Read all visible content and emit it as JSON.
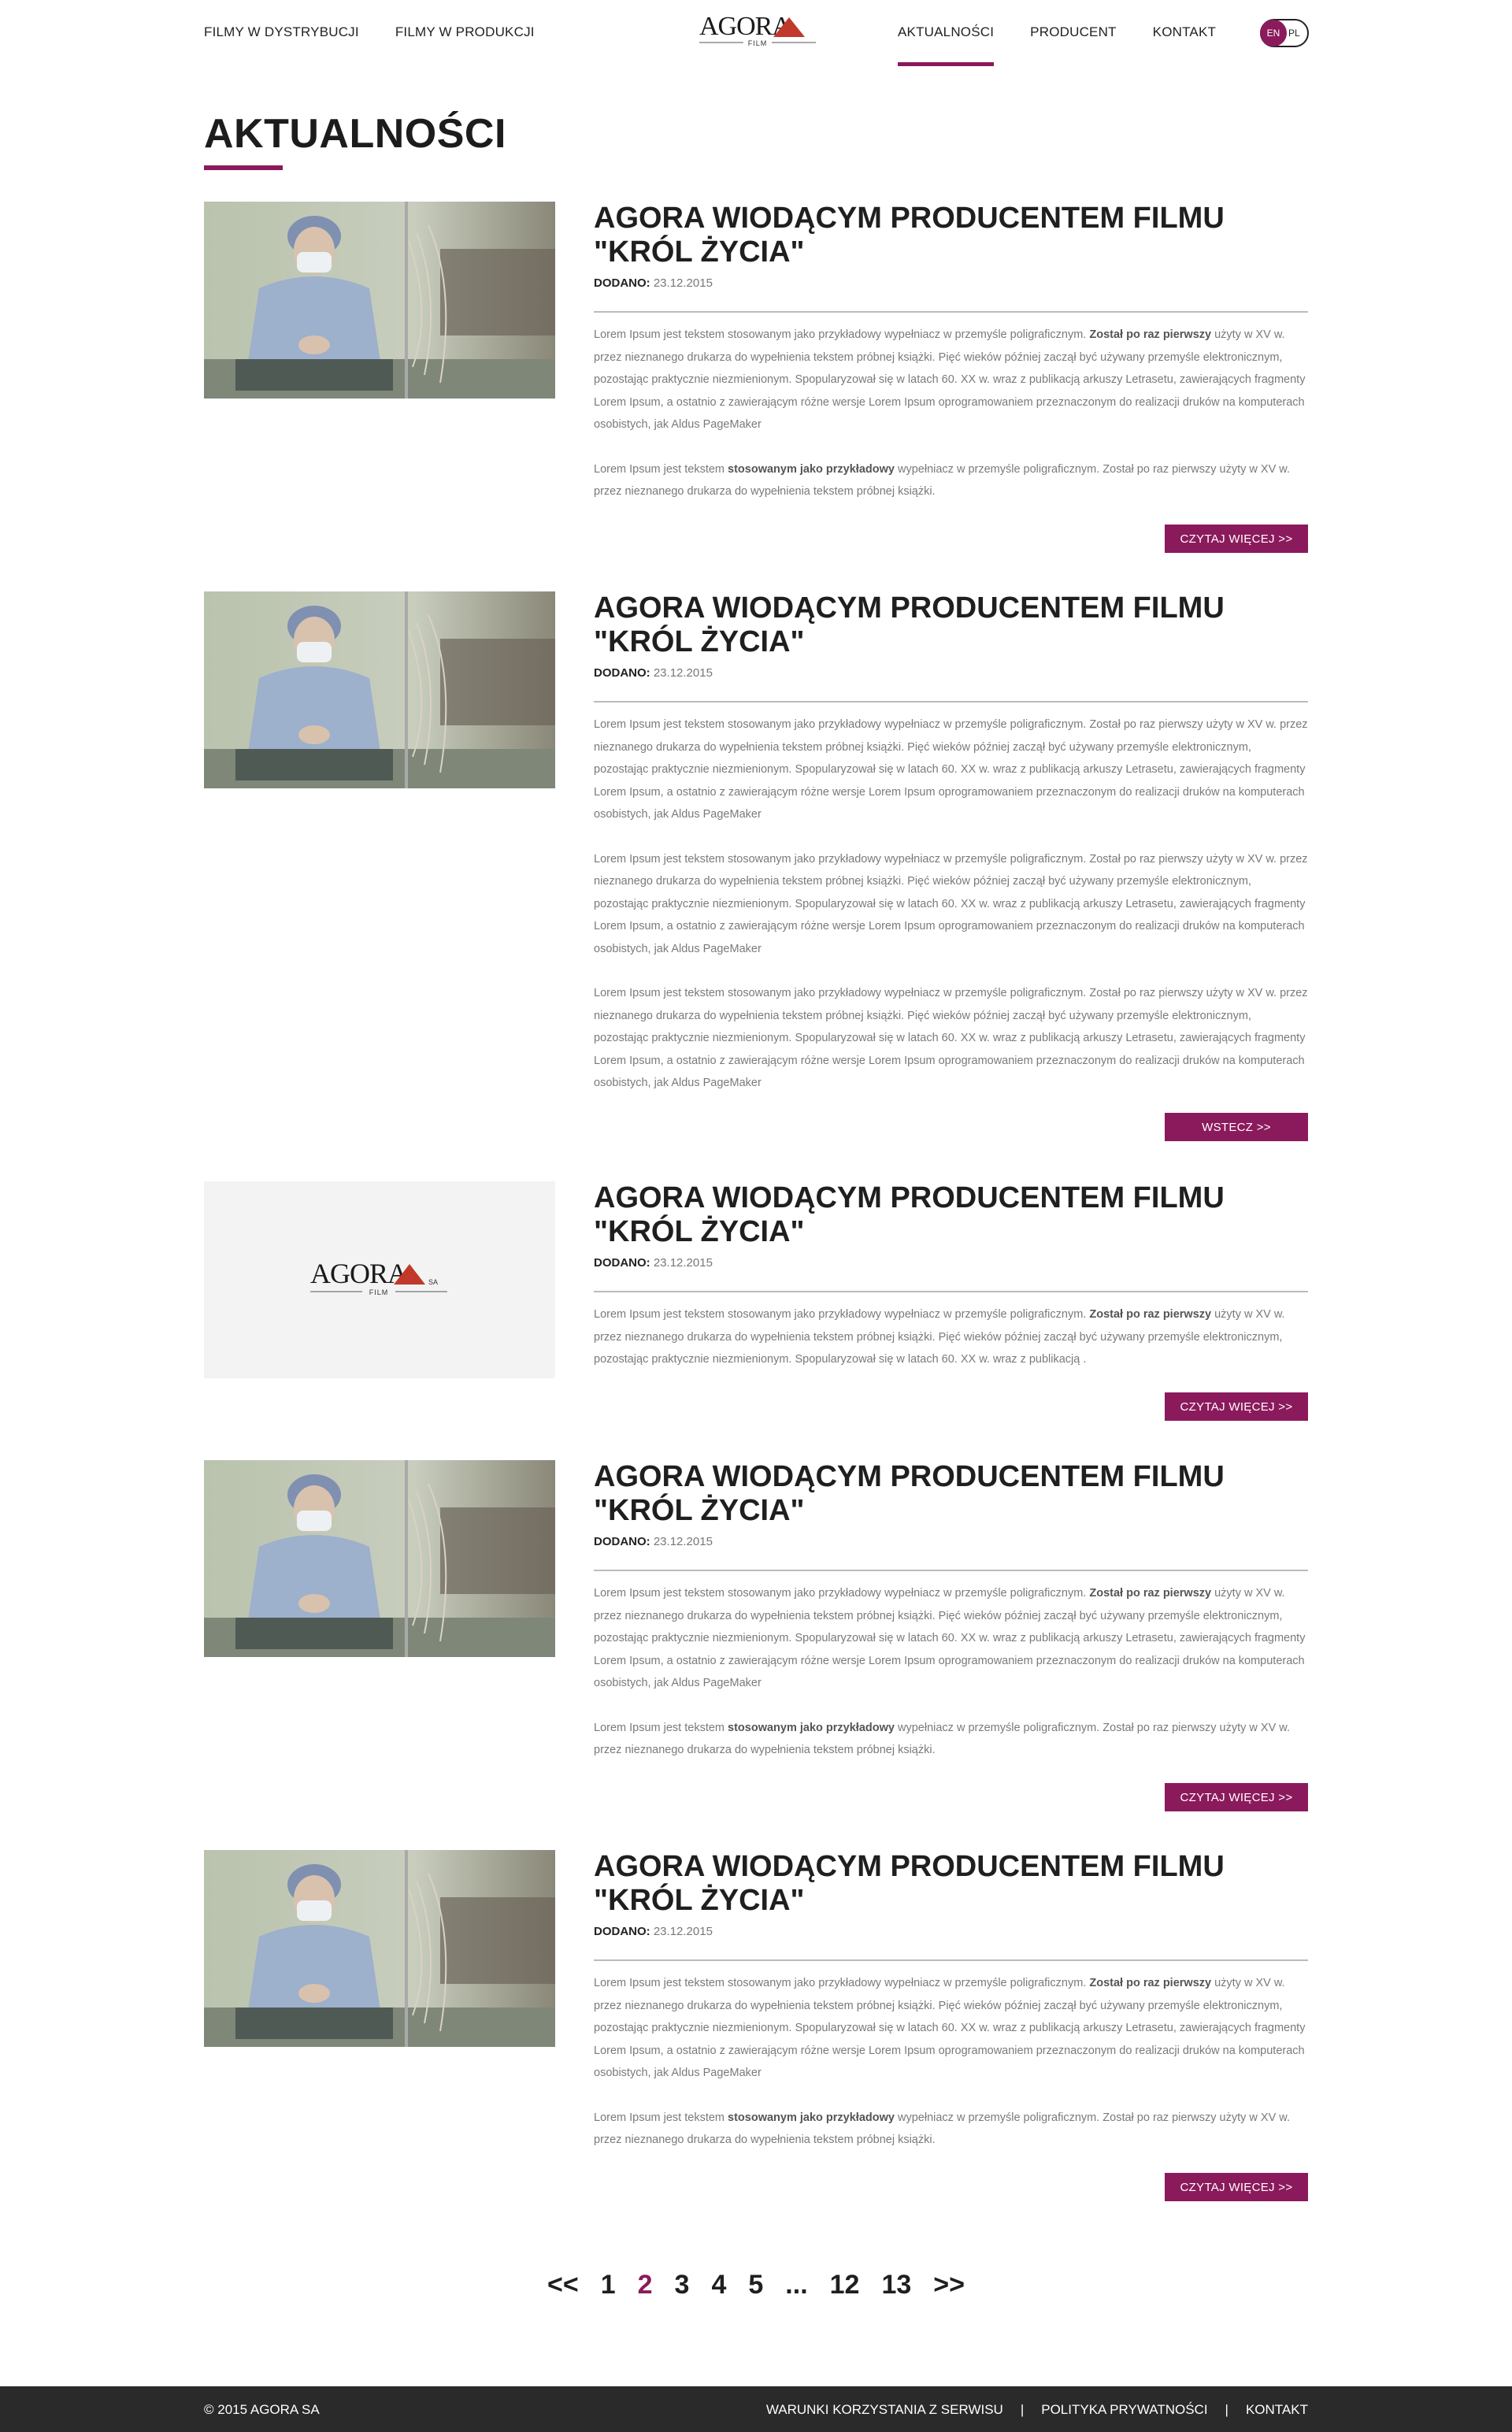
{
  "header": {
    "nav_left": [
      "FILMY W DYSTRYBUCJI",
      "FILMY W PRODUKCJI"
    ],
    "nav_right": [
      "AKTUALNOŚCI",
      "PRODUCENT",
      "KONTAKT"
    ],
    "active": "AKTUALNOŚCI",
    "logo_text": "AGORA",
    "logo_sub": "FILM",
    "lang": {
      "active": "EN",
      "other": "PL"
    }
  },
  "page": {
    "title": "AKTUALNOŚCI"
  },
  "colors": {
    "accent": "#8b1a5c",
    "footer_bg": "#2a2a2a"
  },
  "articles": [
    {
      "title_line1": "AGORA WIODĄCYM PRODUCENTEM FILMU",
      "title_line2": "\"KRÓL ŻYCIA\"",
      "meta_label": "DODANO:",
      "date": "23.12.2015",
      "button": "CZYTAJ WIĘCEJ >>",
      "image": "photo"
    },
    {
      "title_line1": "AGORA WIODĄCYM PRODUCENTEM FILMU",
      "title_line2": "\"KRÓL ŻYCIA\"",
      "meta_label": "DODANO:",
      "date": "23.12.2015",
      "button": "WSTECZ >>",
      "image": "photo"
    },
    {
      "title_line1": "AGORA WIODĄCYM PRODUCENTEM FILMU",
      "title_line2": "\"KRÓL ŻYCIA\"",
      "meta_label": "DODANO:",
      "date": "23.12.2015",
      "button": "CZYTAJ WIĘCEJ >>",
      "image": "logo",
      "logo_text": "AGORA",
      "logo_suffix": "SA",
      "logo_sub": "FILM"
    },
    {
      "title_line1": "AGORA WIODĄCYM PRODUCENTEM FILMU",
      "title_line2": "\"KRÓL ŻYCIA\"",
      "meta_label": "DODANO:",
      "date": "23.12.2015",
      "button": "CZYTAJ WIĘCEJ >>",
      "image": "photo"
    },
    {
      "title_line1": "AGORA WIODĄCYM PRODUCENTEM FILMU",
      "title_line2": "\"KRÓL ŻYCIA\"",
      "meta_label": "DODANO:",
      "date": "23.12.2015",
      "button": "CZYTAJ WIĘCEJ >>",
      "image": "photo"
    }
  ],
  "texts": {
    "p1_pre": "Lorem Ipsum jest tekstem stosowanym jako przykładowy wypełniacz w przemyśle poligraficznym. ",
    "p1_bold": "Został po raz pierwszy",
    "p1_post": " użyty w XV w. przez nieznanego drukarza do wypełnienia tekstem próbnej książki. Pięć wieków później zaczął być używany przemyśle elektronicznym, pozostając praktycznie niezmienionym. Spopularyzował się w latach 60. XX w. wraz z publikacją arkuszy Letrasetu, zawierających fragmenty Lorem Ipsum, a ostatnio z zawierającym różne wersje Lorem Ipsum oprogramowaniem przeznaczonym do realizacji druków na komputerach osobistych, jak Aldus PageMaker",
    "p2_pre": "Lorem Ipsum jest tekstem ",
    "p2_bold": "stosowanym jako przykładowy",
    "p2_post": " wypełniacz w przemyśle poligraficznym. Został po raz pierwszy użyty w XV w. przez nieznanego drukarza do wypełnienia tekstem próbnej książki.",
    "full": "Lorem Ipsum jest tekstem stosowanym jako przykładowy wypełniacz w przemyśle poligraficznym. Został po raz pierwszy użyty w XV w. przez nieznanego drukarza do wypełnienia tekstem próbnej książki. Pięć wieków później zaczął być używany przemyśle elektronicznym, pozostając praktycznie niezmienionym. Spopularyzował się w latach 60. XX w. wraz z publikacją arkuszy Letrasetu, zawierających fragmenty Lorem Ipsum, a ostatnio z zawierającym różne wersje Lorem Ipsum oprogramowaniem przeznaczonym do realizacji druków na komputerach osobistych, jak Aldus PageMaker",
    "short_post": " użyty w XV w. przez nieznanego drukarza do wypełnienia tekstem próbnej książki. Pięć wieków później zaczął być używany przemyśle elektronicznym, pozostając praktycznie niezmienionym. Spopularyzował się w latach 60. XX w. wraz z publikacją ."
  },
  "pagination": [
    "<<",
    "1",
    "2",
    "3",
    "4",
    "5",
    "...",
    "12",
    "13",
    ">>"
  ],
  "pagination_current": "2",
  "footer": {
    "copyright": "© 2015 AGORA SA",
    "links": [
      "WARUNKI KORZYSTANIA Z SERWISU",
      "POLITYKA PRYWATNOŚCI",
      "KONTAKT"
    ],
    "separator": "|"
  }
}
